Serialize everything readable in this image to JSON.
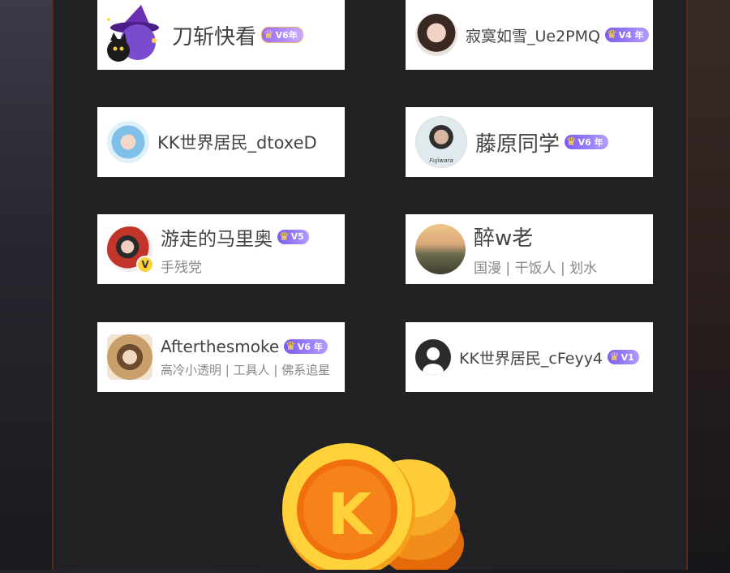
{
  "users": [
    {
      "name": "刀斩快看",
      "bio": "",
      "level": "V6年"
    },
    {
      "name": "寂寞如雪_Ue2PMQ",
      "bio": "",
      "level": "V4 年"
    },
    {
      "name": "KK世界居民_dtoxeD",
      "bio": "",
      "level": ""
    },
    {
      "name": "藤原同学",
      "bio": "",
      "level": "V6 年"
    },
    {
      "name": "游走的马里奥",
      "bio": "手残党",
      "level": "V5"
    },
    {
      "name": "醉w老",
      "bio": "国漫 | 干饭人 | 划水",
      "level": ""
    },
    {
      "name": "Afterthesmoke",
      "bio": "高冷小透明 | 工具人 | 佛系追星",
      "level": "V6 年"
    },
    {
      "name": "KK世界居民_cFeyy4",
      "bio": "",
      "level": "V1"
    }
  ],
  "coin_letter": "K",
  "verified_mark": "V",
  "avatar_text_fujiwara": "Fujiwara"
}
